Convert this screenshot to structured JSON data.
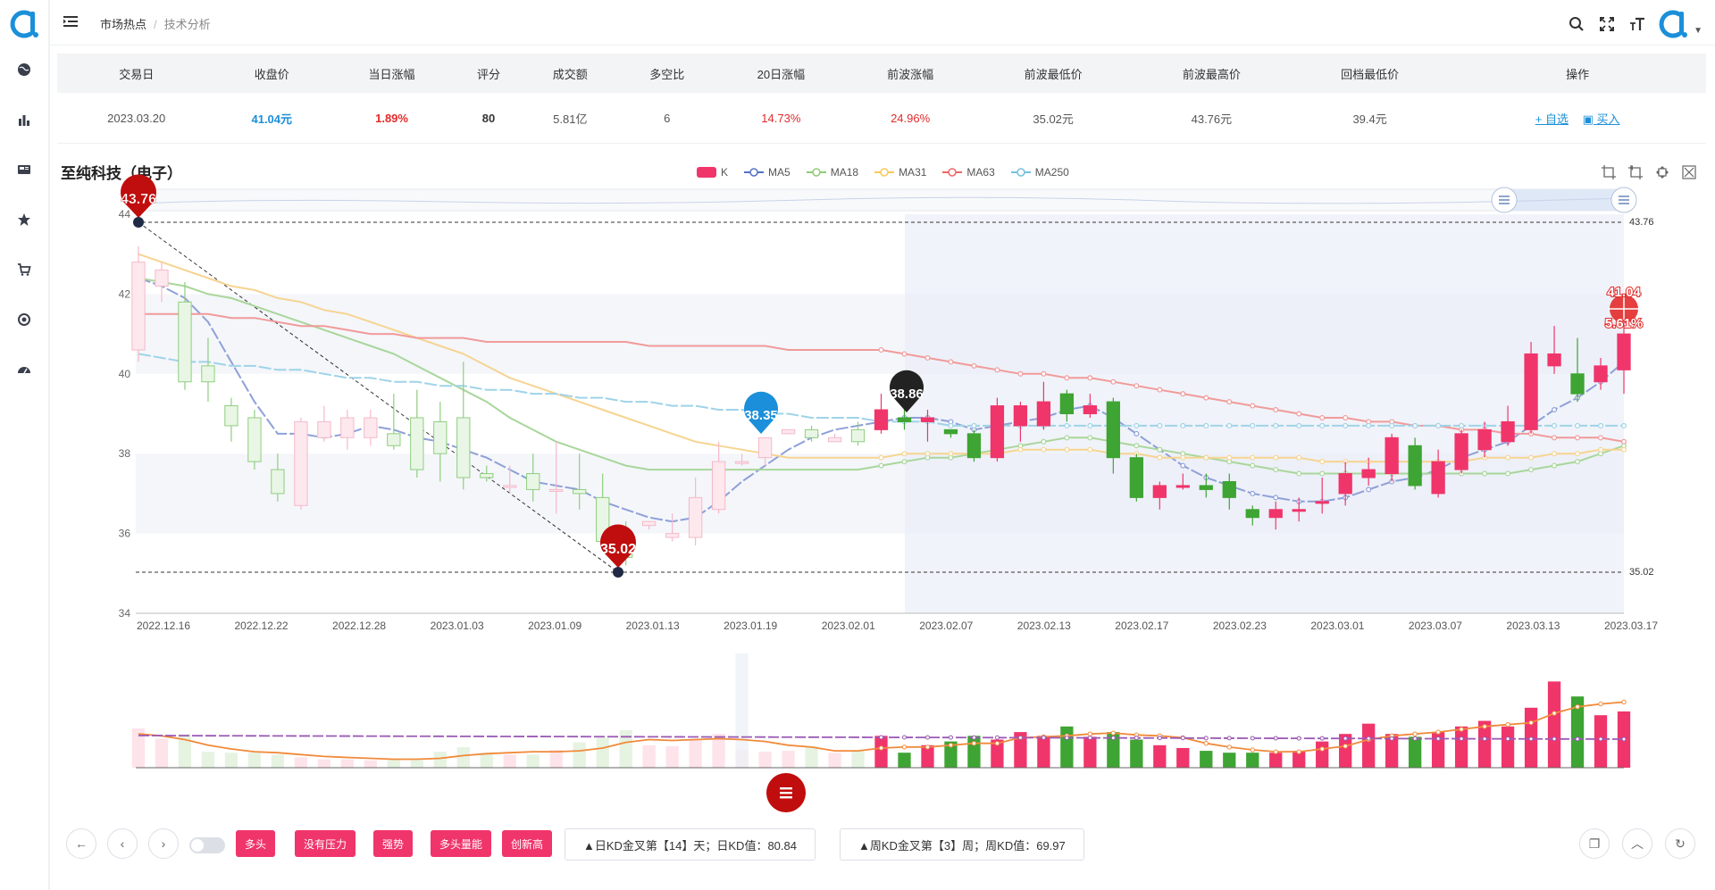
{
  "header": {
    "breadcrumb": [
      "市场热点",
      "技术分析"
    ]
  },
  "sidebar": {
    "items": [
      {
        "icon": "globe-icon"
      },
      {
        "icon": "bar-chart-icon"
      },
      {
        "icon": "newspaper-icon"
      },
      {
        "icon": "star-icon"
      },
      {
        "icon": "cart-icon"
      },
      {
        "icon": "target-icon"
      },
      {
        "icon": "dashboard-icon"
      }
    ]
  },
  "table": {
    "headers": [
      "交易日",
      "收盘价",
      "当日涨幅",
      "评分",
      "成交额",
      "多空比",
      "20日涨幅",
      "前波涨幅",
      "前波最低价",
      "前波最高价",
      "回档最低价",
      "操作"
    ],
    "row": {
      "date": "2023.03.20",
      "close": "41.04元",
      "change": "1.89%",
      "score": "80",
      "turnover": "5.81亿",
      "ratio": "6",
      "chg20": "14.73%",
      "prev_wave": "24.96%",
      "prev_low": "35.02元",
      "prev_high": "43.76元",
      "pullback_low": "39.4元",
      "actions": [
        "+ 自选",
        "买入"
      ]
    }
  },
  "chart": {
    "title": "至纯科技（电子）",
    "legend": [
      {
        "label": "K",
        "color": "#f0356b"
      },
      {
        "label": "MA5",
        "color": "#5470c6"
      },
      {
        "label": "MA18",
        "color": "#91cc75"
      },
      {
        "label": "MA31",
        "color": "#fac858"
      },
      {
        "label": "MA63",
        "color": "#ee6666"
      },
      {
        "label": "MA250",
        "color": "#73c0de"
      }
    ],
    "markers": {
      "high": "43.76",
      "low": "35.02",
      "mark1": "38.35",
      "mark2": "38.86",
      "last_price": "41.04",
      "last_pct": "5.61%",
      "right_high": "43.76",
      "right_low": "35.02"
    }
  },
  "chart_data": {
    "type": "candlestick",
    "ylim": [
      34,
      44
    ],
    "yticks": [
      "34",
      "36",
      "38",
      "40",
      "42",
      "44"
    ],
    "xticks": [
      "2022.12.16",
      "2022.12.22",
      "2022.12.28",
      "2023.01.03",
      "2023.01.09",
      "2023.01.13",
      "2023.01.19",
      "2023.02.01",
      "2023.02.07",
      "2023.02.13",
      "2023.02.17",
      "2023.02.23",
      "2023.03.01",
      "2023.03.07",
      "2023.03.13",
      "2023.03.17"
    ],
    "series": [
      {
        "name": "K",
        "ohlc": [
          [
            40.6,
            42.8,
            40.3,
            43.2
          ],
          [
            42.2,
            42.6,
            41.8,
            42.8
          ],
          [
            41.8,
            39.8,
            39.6,
            42.3
          ],
          [
            40.2,
            39.8,
            39.3,
            40.9
          ],
          [
            39.2,
            38.7,
            38.3,
            39.4
          ],
          [
            38.9,
            37.8,
            37.6,
            39.1
          ],
          [
            37.6,
            37.0,
            36.8,
            38.0
          ],
          [
            36.7,
            38.8,
            36.6,
            38.9
          ],
          [
            38.4,
            38.8,
            38.3,
            39.2
          ],
          [
            38.4,
            38.9,
            38.1,
            39.1
          ],
          [
            38.4,
            38.9,
            38.2,
            39.1
          ],
          [
            38.5,
            38.2,
            38.1,
            39.5
          ],
          [
            38.9,
            37.6,
            37.4,
            39.6
          ],
          [
            38.8,
            38.0,
            37.3,
            39.3
          ],
          [
            38.9,
            37.4,
            37.1,
            40.3
          ],
          [
            37.5,
            37.4,
            37.3,
            37.7
          ],
          [
            37.2,
            37.2,
            37.0,
            37.7
          ],
          [
            37.5,
            37.1,
            36.8,
            38.0
          ],
          [
            37.1,
            37.1,
            36.5,
            38.3
          ],
          [
            37.1,
            37.0,
            36.6,
            38.0
          ],
          [
            36.9,
            35.8,
            35.6,
            37.5
          ],
          [
            35.8,
            35.4,
            35.2,
            36.3
          ],
          [
            36.2,
            36.3,
            36.1,
            36.3
          ],
          [
            35.9,
            36.0,
            35.8,
            36.5
          ],
          [
            35.9,
            36.9,
            35.7,
            37.4
          ],
          [
            36.6,
            37.8,
            36.5,
            38.3
          ],
          [
            37.8,
            37.8,
            37.7,
            38.0
          ],
          [
            37.9,
            38.4,
            37.7,
            38.4
          ],
          [
            38.5,
            38.6,
            38.5,
            38.6
          ],
          [
            38.6,
            38.4,
            38.3,
            38.7
          ],
          [
            38.3,
            38.4,
            38.3,
            38.5
          ],
          [
            38.6,
            38.3,
            38.2,
            38.8
          ],
          [
            38.6,
            39.1,
            38.5,
            39.5
          ],
          [
            38.9,
            38.8,
            38.6,
            39.2
          ],
          [
            38.8,
            38.9,
            38.3,
            39.1
          ],
          [
            38.6,
            38.5,
            38.4,
            38.6
          ],
          [
            38.5,
            37.9,
            37.8,
            38.6
          ],
          [
            37.9,
            39.2,
            37.8,
            39.4
          ],
          [
            38.7,
            39.2,
            38.3,
            39.3
          ],
          [
            38.7,
            39.3,
            38.6,
            39.8
          ],
          [
            39.5,
            39.0,
            38.8,
            39.6
          ],
          [
            39.0,
            39.2,
            38.9,
            39.5
          ],
          [
            39.3,
            37.9,
            37.5,
            39.4
          ],
          [
            37.9,
            36.9,
            36.8,
            38.0
          ],
          [
            36.9,
            37.2,
            36.6,
            37.3
          ],
          [
            37.2,
            37.2,
            37.1,
            37.5
          ],
          [
            37.2,
            37.1,
            36.9,
            37.5
          ],
          [
            37.3,
            36.9,
            36.6,
            37.5
          ],
          [
            36.6,
            36.4,
            36.2,
            36.7
          ],
          [
            36.4,
            36.6,
            36.1,
            36.8
          ],
          [
            36.6,
            36.6,
            36.3,
            36.9
          ],
          [
            36.8,
            36.8,
            36.5,
            37.4
          ],
          [
            37.0,
            37.5,
            36.7,
            37.8
          ],
          [
            37.4,
            37.6,
            37.2,
            37.9
          ],
          [
            37.5,
            38.4,
            37.3,
            38.5
          ],
          [
            38.2,
            37.2,
            37.1,
            38.4
          ],
          [
            37.0,
            37.8,
            36.9,
            38.1
          ],
          [
            37.6,
            38.5,
            37.5,
            38.6
          ],
          [
            38.1,
            38.6,
            37.9,
            38.8
          ],
          [
            38.3,
            38.8,
            38.2,
            39.2
          ],
          [
            38.6,
            40.5,
            38.5,
            40.8
          ],
          [
            40.2,
            40.5,
            40.0,
            41.2
          ],
          [
            40.0,
            39.5,
            39.3,
            40.9
          ],
          [
            39.8,
            40.2,
            39.6,
            40.4
          ],
          [
            40.1,
            41.0,
            39.5,
            41.9
          ]
        ]
      },
      {
        "name": "MA5",
        "values": [
          42.4,
          42.2,
          41.9,
          41.3,
          40.3,
          39.3,
          38.5,
          38.5,
          38.4,
          38.5,
          38.7,
          38.6,
          38.4,
          38.3,
          38.1,
          37.9,
          37.6,
          37.3,
          37.2,
          37.1,
          36.8,
          36.6,
          36.4,
          36.3,
          36.4,
          36.8,
          37.3,
          37.7,
          38.1,
          38.4,
          38.6,
          38.7,
          38.8,
          38.9,
          38.9,
          38.8,
          38.6,
          38.7,
          38.8,
          38.9,
          39.1,
          39.2,
          38.9,
          38.5,
          38.1,
          37.7,
          37.4,
          37.2,
          37.0,
          36.9,
          36.8,
          36.8,
          36.9,
          37.1,
          37.3,
          37.4,
          37.6,
          37.9,
          38.1,
          38.3,
          38.7,
          39.1,
          39.4,
          39.8,
          40.3
        ]
      },
      {
        "name": "MA18",
        "values": [
          42.4,
          42.3,
          42.2,
          42.0,
          41.9,
          41.7,
          41.5,
          41.3,
          41.1,
          40.9,
          40.7,
          40.5,
          40.2,
          39.9,
          39.6,
          39.3,
          38.9,
          38.6,
          38.3,
          38.1,
          37.9,
          37.7,
          37.6,
          37.6,
          37.6,
          37.6,
          37.6,
          37.6,
          37.6,
          37.6,
          37.6,
          37.6,
          37.7,
          37.8,
          37.9,
          37.9,
          38.0,
          38.1,
          38.2,
          38.3,
          38.4,
          38.4,
          38.3,
          38.2,
          38.1,
          38.0,
          37.9,
          37.8,
          37.7,
          37.6,
          37.5,
          37.5,
          37.5,
          37.5,
          37.5,
          37.5,
          37.5,
          37.5,
          37.5,
          37.5,
          37.6,
          37.7,
          37.8,
          38.0,
          38.2
        ]
      },
      {
        "name": "MA31",
        "values": [
          43.0,
          42.8,
          42.6,
          42.4,
          42.2,
          42.1,
          41.9,
          41.8,
          41.6,
          41.5,
          41.3,
          41.1,
          40.9,
          40.7,
          40.5,
          40.2,
          39.9,
          39.7,
          39.5,
          39.3,
          39.1,
          38.9,
          38.7,
          38.5,
          38.3,
          38.2,
          38.1,
          38.0,
          37.9,
          37.9,
          37.9,
          37.9,
          37.9,
          38.0,
          38.0,
          38.0,
          38.0,
          38.0,
          38.1,
          38.1,
          38.1,
          38.1,
          38.0,
          38.0,
          37.9,
          37.9,
          37.9,
          37.9,
          37.9,
          37.9,
          37.9,
          37.8,
          37.8,
          37.8,
          37.8,
          37.8,
          37.8,
          37.8,
          37.9,
          37.9,
          37.9,
          38.0,
          38.0,
          38.1,
          38.1
        ]
      },
      {
        "name": "MA63",
        "values": [
          41.5,
          41.5,
          41.5,
          41.5,
          41.4,
          41.4,
          41.3,
          41.2,
          41.2,
          41.1,
          41.0,
          41.0,
          40.9,
          40.9,
          40.9,
          40.8,
          40.8,
          40.8,
          40.8,
          40.8,
          40.8,
          40.8,
          40.7,
          40.7,
          40.7,
          40.7,
          40.7,
          40.7,
          40.6,
          40.6,
          40.6,
          40.6,
          40.6,
          40.5,
          40.4,
          40.3,
          40.2,
          40.1,
          40.0,
          40.0,
          39.9,
          39.9,
          39.8,
          39.7,
          39.6,
          39.5,
          39.4,
          39.3,
          39.2,
          39.1,
          39.0,
          38.9,
          38.9,
          38.8,
          38.8,
          38.7,
          38.7,
          38.6,
          38.6,
          38.5,
          38.5,
          38.4,
          38.4,
          38.4,
          38.3
        ]
      },
      {
        "name": "MA250",
        "values": [
          40.5,
          40.4,
          40.3,
          40.3,
          40.2,
          40.2,
          40.1,
          40.1,
          40.0,
          39.9,
          39.9,
          39.8,
          39.8,
          39.7,
          39.7,
          39.6,
          39.6,
          39.5,
          39.5,
          39.4,
          39.4,
          39.3,
          39.3,
          39.2,
          39.2,
          39.1,
          39.1,
          39.0,
          39.0,
          38.9,
          38.9,
          38.9,
          38.8,
          38.8,
          38.8,
          38.7,
          38.7,
          38.7,
          38.7,
          38.7,
          38.7,
          38.7,
          38.7,
          38.7,
          38.7,
          38.7,
          38.7,
          38.7,
          38.7,
          38.7,
          38.7,
          38.7,
          38.7,
          38.7,
          38.7,
          38.7,
          38.7,
          38.7,
          38.7,
          38.7,
          38.7,
          38.7,
          38.7,
          38.7,
          38.7
        ]
      },
      {
        "name": "volume",
        "values": [
          42,
          31,
          36,
          17,
          16,
          16,
          14,
          11,
          9,
          9,
          8,
          9,
          8,
          17,
          22,
          16,
          14,
          14,
          19,
          27,
          32,
          40,
          24,
          23,
          30,
          36,
          19,
          17,
          18,
          23,
          16,
          18,
          34,
          16,
          24,
          28,
          34,
          30,
          38,
          34,
          44,
          33,
          38,
          30,
          24,
          21,
          18,
          16,
          16,
          16,
          18,
          28,
          36,
          47,
          36,
          33,
          38,
          44,
          50,
          44,
          64,
          92,
          76,
          56,
          60
        ]
      },
      {
        "name": "volume_ma5",
        "values": [
          36,
          34,
          30,
          24,
          20,
          17,
          16,
          14,
          12,
          11,
          10,
          9,
          9,
          10,
          13,
          15,
          16,
          17,
          17,
          18,
          21,
          27,
          30,
          29,
          30,
          31,
          30,
          28,
          24,
          22,
          18,
          18,
          21,
          22,
          22,
          24,
          26,
          26,
          32,
          33,
          34,
          36,
          37,
          35,
          34,
          32,
          26,
          22,
          19,
          17,
          17,
          20,
          23,
          30,
          34,
          36,
          38,
          41,
          44,
          46,
          48,
          58,
          65,
          68,
          70
        ]
      }
    ],
    "annotations": [
      "43.76",
      "35.02",
      "38.35",
      "38.86",
      "41.04",
      "5.61%"
    ]
  },
  "bottom": {
    "tags": [
      "多头",
      "没有压力",
      "强势",
      "多头量能",
      "创新高"
    ],
    "info": [
      "▲日KD金叉第【14】天；日KD值：80.84",
      "▲周KD金叉第【3】周；周KD值：69.97"
    ]
  }
}
